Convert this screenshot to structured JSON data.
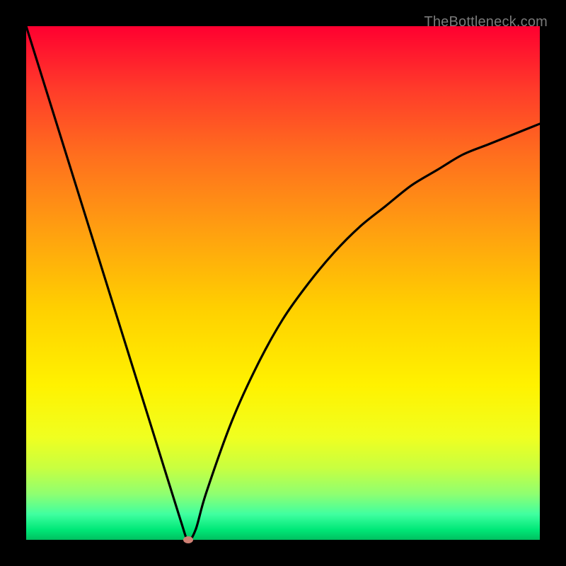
{
  "watermark": "TheBottleneck.com",
  "chart_data": {
    "type": "line",
    "title": "",
    "xlabel": "",
    "ylabel": "",
    "xlim": [
      0,
      100
    ],
    "ylim": [
      0,
      100
    ],
    "grid": false,
    "legend": false,
    "background_gradient": {
      "top": "#ff0030",
      "bottom": "#00c060"
    },
    "series": [
      {
        "name": "bottleneck-curve",
        "x": [
          0,
          5,
          10,
          15,
          20,
          25,
          30,
          31.5,
          33,
          35,
          40,
          45,
          50,
          55,
          60,
          65,
          70,
          75,
          80,
          85,
          90,
          95,
          100
        ],
        "values": [
          100,
          84,
          68,
          52,
          36,
          20,
          4,
          0,
          2,
          9,
          23,
          34,
          43,
          50,
          56,
          61,
          65,
          69,
          72,
          75,
          77,
          79,
          81
        ]
      }
    ],
    "marker": {
      "name": "optimal-point",
      "x": 31.5,
      "y": 0,
      "color": "#d08074"
    }
  }
}
